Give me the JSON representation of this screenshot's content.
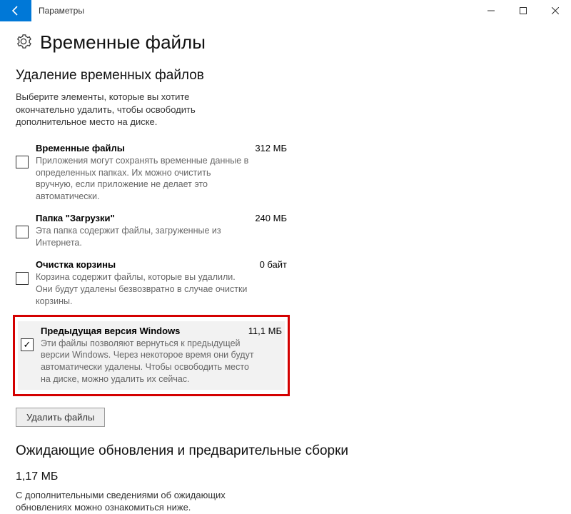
{
  "titlebar": {
    "title": "Параметры"
  },
  "page": {
    "title": "Временные файлы"
  },
  "section": {
    "heading": "Удаление временных файлов",
    "description": "Выберите элементы, которые вы хотите окончательно удалить, чтобы освободить дополнительное место на диске."
  },
  "items": [
    {
      "title": "Временные файлы",
      "size": "312 МБ",
      "desc": "Приложения могут сохранять временные данные в определенных папках. Их можно очистить вручную, если приложение не делает это автоматически.",
      "checked": false
    },
    {
      "title": "Папка \"Загрузки\"",
      "size": "240 МБ",
      "desc": "Эта папка содержит файлы, загруженные из Интернета.",
      "checked": false
    },
    {
      "title": "Очистка корзины",
      "size": "0 байт",
      "desc": "Корзина содержит файлы, которые вы удалили. Они будут удалены безвозвратно в случае очистки корзины.",
      "checked": false
    },
    {
      "title": "Предыдущая версия Windows",
      "size": "11,1 МБ",
      "desc": "Эти файлы позволяют вернуться к предыдущей версии Windows. Через некоторое время они будут автоматически удалены. Чтобы освободить место на диске, можно удалить их сейчас.",
      "checked": true
    }
  ],
  "buttons": {
    "delete": "Удалить файлы"
  },
  "pending": {
    "heading": "Ожидающие обновления и предварительные сборки",
    "size": "1,17 МБ",
    "desc": "С дополнительными сведениями об ожидающих обновлениях можно ознакомиться ниже."
  }
}
